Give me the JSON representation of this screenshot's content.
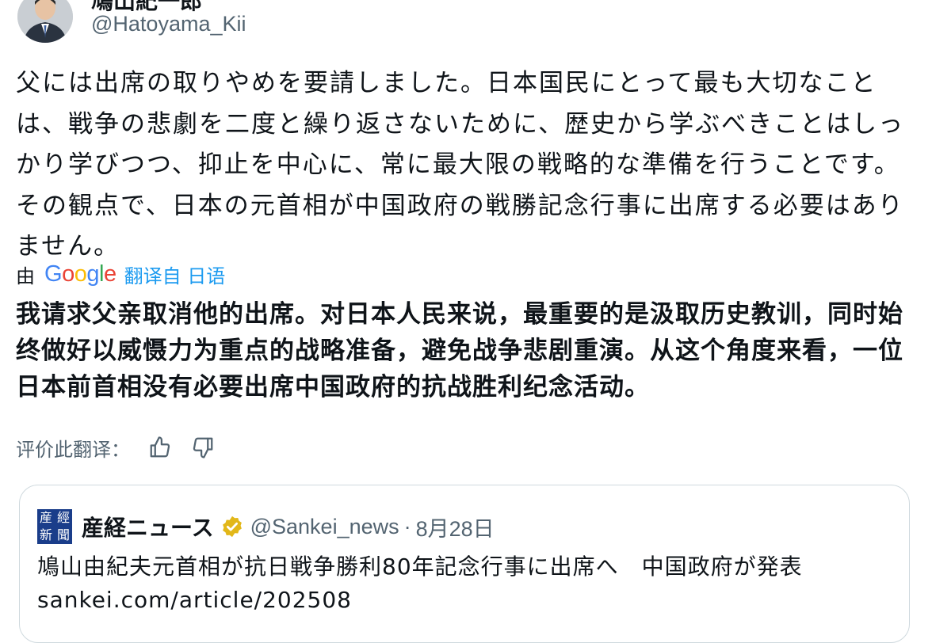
{
  "author": {
    "name": "鳩山紀一郎",
    "handle": "@Hatoyama_Kii"
  },
  "tweet": {
    "text": "父には出席の取りやめを要請しました。日本国民にとって最も大切なことは、戦争の悲劇を二度と繰り返さないために、歴史から学ぶべきことはしっかり学びつつ、抑止を中心に、常に最大限の戦略的な準備を行うことです。その観点で、日本の元首相が中国政府の戦勝記念行事に出席する必要はありません。"
  },
  "translation": {
    "by_label": "由",
    "provider": "Google",
    "from_label": "翻译自 日语",
    "text": "我请求父亲取消他的出席。对日本人民来说，最重要的是汲取历史教训，同时始终做好以威慑力为重点的战略准备，避免战争悲剧重演。从这个角度来看，一位日本前首相没有必要出席中国政府的抗战胜利纪念活动。",
    "rate_label": "评价此翻译："
  },
  "quote": {
    "logo_chars": [
      "産",
      "經",
      "新",
      "聞"
    ],
    "name": "産経ニュース",
    "handle": "@Sankei_news",
    "separator": "·",
    "date": "8月28日",
    "text": "鳩山由紀夫元首相が抗日戦争勝利80年記念行事に出席へ　中国政府が発表",
    "link": "sankei.com/article/202508"
  },
  "icons": {
    "thumbs_up": "thumbs-up-icon",
    "thumbs_down": "thumbs-down-icon",
    "verified": "verified-badge-icon"
  },
  "colors": {
    "link_blue": "#1d9bf0",
    "muted": "#536471",
    "verified_gold": "#e2b719",
    "logo_blue": "#1a3d8a"
  }
}
